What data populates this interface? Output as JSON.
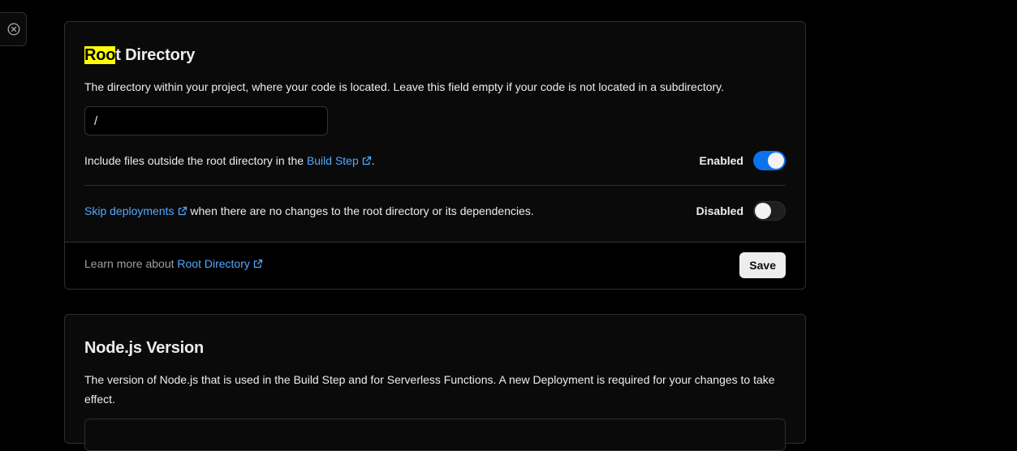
{
  "side_tab": {
    "icon": "close-circle-icon"
  },
  "root_directory": {
    "title_highlight": "Roo",
    "title_rest": "t Directory",
    "description": "The directory within your project, where your code is located. Leave this field empty if your code is not located in a subdirectory.",
    "input_value": "/",
    "include_files": {
      "text_before": "Include files outside the root directory in the ",
      "link": "Build Step",
      "text_after": ".",
      "state": "Enabled",
      "enabled": true
    },
    "skip_deployments": {
      "link": "Skip deployments",
      "text_after": " when there are no changes to the root directory or its dependencies.",
      "state": "Disabled",
      "enabled": false
    },
    "footer": {
      "text": "Learn more about ",
      "link": "Root Directory",
      "save_label": "Save"
    }
  },
  "node_version": {
    "title": "Node.js Version",
    "description": "The version of Node.js that is used in the Build Step and for Serverless Functions. A new Deployment is required for your changes to take effect."
  },
  "colors": {
    "background": "#000000",
    "card": "#0a0a0a",
    "border": "#2e2e2e",
    "link": "#52a8ff",
    "toggle_on": "#0a72ef",
    "highlight": "#ffff00"
  }
}
